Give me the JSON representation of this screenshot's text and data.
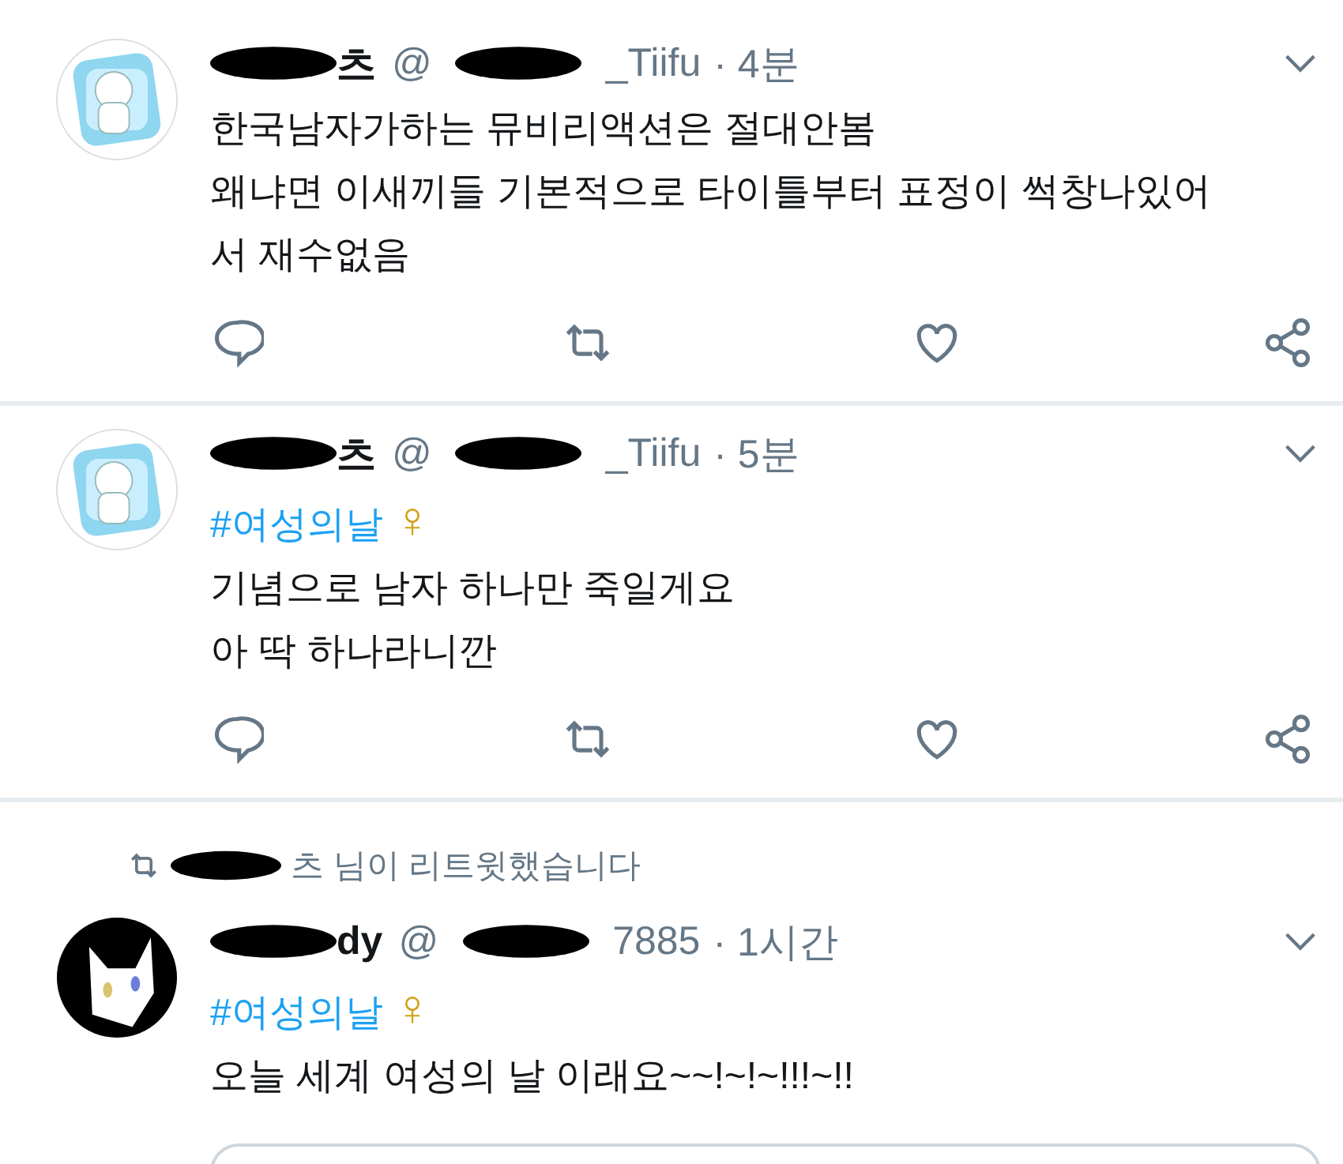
{
  "tweets": [
    {
      "name_visible": "츠",
      "handle_start": "@",
      "handle_end": "_Tiifu",
      "time": "· 4분",
      "lines": [
        "한국남자가하는 뮤비리액션은 절대안봄",
        "왜냐면 이새끼들 기본적으로 타이틀부터 표정이 썩창나있어",
        "서 재수없음"
      ],
      "actions": true,
      "card": false
    },
    {
      "name_visible": "츠",
      "handle_start": "@",
      "handle_end": "_Tiifu",
      "time": "· 5분",
      "hashtag": {
        "tag": "#여성의날",
        "symbol": "♀"
      },
      "lines": [
        "기념으로 남자 하나만 죽일게요",
        "아 딱 하나라니깐"
      ],
      "actions": true,
      "card": false
    },
    {
      "retweeted_by": "츠 님이 리트윗했습니다",
      "name_visible": "dy",
      "handle_start": "@",
      "handle_end": "7885",
      "time": "· 1시간",
      "hashtag": {
        "tag": "#여성의날",
        "symbol": "♀"
      },
      "lines": [
        " 오늘 세계 여성의 날 이래요~~!~!~!!!~!!"
      ],
      "actions": false,
      "card": true
    }
  ]
}
